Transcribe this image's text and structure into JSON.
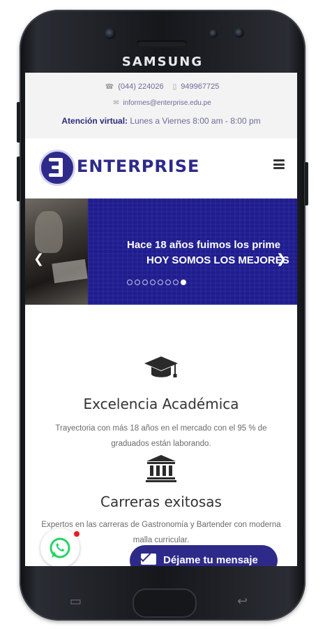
{
  "device": {
    "brand": "SAMSUNG"
  },
  "topbar": {
    "phone1": "(044) 224026",
    "phone2": "949967725",
    "email": "informes@enterprise.edu.pe",
    "attention_label": "Atención virtual:",
    "attention_hours": "Lunes a Viernes 8:00 am - 8:00 pm"
  },
  "header": {
    "logo_text": "ENTERPRISE"
  },
  "slider": {
    "line1": "Hace 18 años fuimos los prime",
    "line2": "HOY SOMOS LOS MEJORES",
    "dots_total": 8,
    "active_dot": 8
  },
  "features": [
    {
      "icon": "graduation-cap-icon",
      "title": "Excelencia Académica",
      "desc": "Trayectoria con más 18 años en el mercado con el  95 % de graduados están laborando."
    },
    {
      "icon": "institution-icon",
      "title": "Carreras exitosas",
      "desc": "Expertos en las carreras de Gastronomía y Bartender con moderna malla curricular."
    }
  ],
  "message_button": {
    "label": "Déjame tu mensaje"
  },
  "colors": {
    "primary": "#2e2a8a",
    "slider_bg": "#1f1c8f",
    "topbar_bg": "#f3f3f3",
    "whatsapp": "#25d366"
  }
}
